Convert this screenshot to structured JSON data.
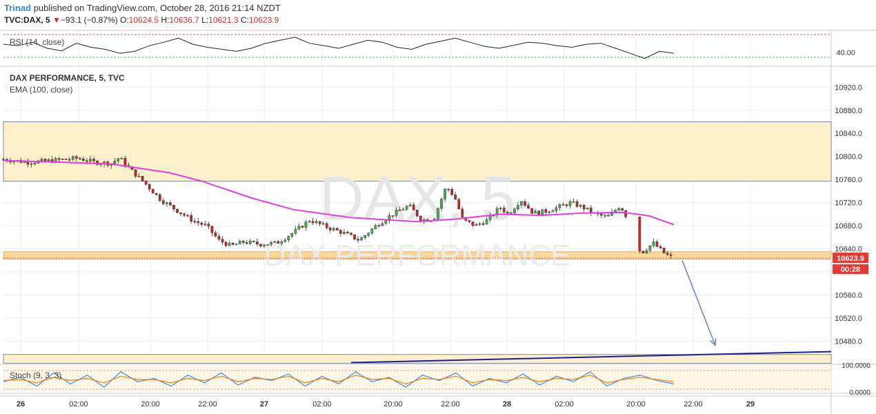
{
  "header": {
    "author": "Trinad",
    "published_text": "published on TradingView.com, October 28, 2016 21:14 NZDT",
    "symbol": "TVC:DAX, 5",
    "change_arrow": "▼",
    "change": "−93.1 (−0.87%)",
    "o_label": "O:",
    "o_value": "10624.5",
    "h_label": "H:",
    "h_value": "10636.7",
    "l_label": "L:",
    "l_value": "10621.3",
    "c_label": "C:",
    "c_value": "10623.9"
  },
  "rsi_pane": {
    "label": "RSI (14, close)",
    "tick": "40.00"
  },
  "main_pane": {
    "title": "DAX PERFORMANCE, 5, TVC",
    "ema_label": "EMA (100, close)",
    "watermark_big": "DAX, 5",
    "watermark_small": "DAX PERFORMANCE",
    "last_price": "10623.9",
    "countdown": "00:28"
  },
  "stoch_pane": {
    "label": "Stoch (9, 3, 3)",
    "tick_top": "100.0000",
    "tick_bottom": "0.0000"
  },
  "colors": {
    "up": "#4caf50",
    "down": "#c62828",
    "ema": "#e53be0",
    "zone": "#fdf0cc",
    "zone_strong": "#fbd79a",
    "trendline": "#1a1aa6",
    "arrow": "#6f86c9",
    "price_tag": "#e53935",
    "stoch_k": "#3a8ee6",
    "stoch_d": "#f57c00"
  },
  "chart_data": {
    "type": "candlestick",
    "y_ticks": [
      "10920.0",
      "10880.0",
      "10840.0",
      "10800.0",
      "10760.0",
      "10720.0",
      "10680.0",
      "10640.0",
      "10560.0",
      "10520.0",
      "10480.0"
    ],
    "ylim": [
      10440,
      10955
    ],
    "x_ticks": [
      "26",
      "02:00",
      "20:00",
      "22:00",
      "27",
      "02:00",
      "20:00",
      "22:00",
      "28",
      "02:00",
      "20:00",
      "22:00",
      "29"
    ],
    "price_path": [
      [
        0,
        10795
      ],
      [
        0.03,
        10790
      ],
      [
        0.06,
        10793
      ],
      [
        0.09,
        10797
      ],
      [
        0.11,
        10790
      ],
      [
        0.13,
        10788
      ],
      [
        0.14,
        10798
      ],
      [
        0.155,
        10775
      ],
      [
        0.17,
        10755
      ],
      [
        0.19,
        10725
      ],
      [
        0.21,
        10706
      ],
      [
        0.23,
        10688
      ],
      [
        0.245,
        10680
      ],
      [
        0.26,
        10655
      ],
      [
        0.275,
        10645
      ],
      [
        0.29,
        10652
      ],
      [
        0.31,
        10648
      ],
      [
        0.33,
        10650
      ],
      [
        0.35,
        10668
      ],
      [
        0.37,
        10690
      ],
      [
        0.39,
        10678
      ],
      [
        0.41,
        10668
      ],
      [
        0.43,
        10655
      ],
      [
        0.45,
        10680
      ],
      [
        0.47,
        10700
      ],
      [
        0.49,
        10715
      ],
      [
        0.505,
        10690
      ],
      [
        0.52,
        10692
      ],
      [
        0.535,
        10748
      ],
      [
        0.545,
        10730
      ],
      [
        0.555,
        10690
      ],
      [
        0.57,
        10680
      ],
      [
        0.585,
        10690
      ],
      [
        0.6,
        10712
      ],
      [
        0.61,
        10700
      ],
      [
        0.625,
        10725
      ],
      [
        0.64,
        10702
      ],
      [
        0.655,
        10705
      ],
      [
        0.67,
        10712
      ],
      [
        0.685,
        10720
      ],
      [
        0.7,
        10712
      ],
      [
        0.715,
        10700
      ],
      [
        0.73,
        10695
      ],
      [
        0.745,
        10715
      ],
      [
        0.755,
        10690
      ],
      [
        0.77,
        10632
      ],
      [
        0.785,
        10650
      ],
      [
        0.8,
        10630
      ],
      [
        0.81,
        10624
      ]
    ],
    "ema_path": [
      [
        0,
        10793
      ],
      [
        0.07,
        10790
      ],
      [
        0.13,
        10787
      ],
      [
        0.2,
        10772
      ],
      [
        0.24,
        10757
      ],
      [
        0.3,
        10728
      ],
      [
        0.35,
        10708
      ],
      [
        0.42,
        10694
      ],
      [
        0.5,
        10687
      ],
      [
        0.55,
        10692
      ],
      [
        0.6,
        10700
      ],
      [
        0.65,
        10698
      ],
      [
        0.7,
        10702
      ],
      [
        0.75,
        10703
      ],
      [
        0.78,
        10697
      ],
      [
        0.81,
        10682
      ]
    ],
    "zones": [
      {
        "y1": 10757,
        "y2": 10860,
        "strength": "normal"
      },
      {
        "y1": 10622,
        "y2": 10635,
        "strength": "strong"
      },
      {
        "y1": 10442,
        "y2": 10457,
        "strength": "normal"
      }
    ],
    "trendline": [
      [
        0.42,
        10443
      ],
      [
        1.0,
        10462
      ]
    ],
    "projection_arrow": [
      [
        0.82,
        10620
      ],
      [
        0.86,
        10473
      ]
    ],
    "rsi_values": [
      58,
      55,
      62,
      50,
      45,
      60,
      52,
      48,
      40,
      44,
      55,
      62,
      70,
      58,
      52,
      48,
      44,
      50,
      60,
      66,
      72,
      60,
      55,
      50,
      58,
      66,
      62,
      52,
      48,
      58,
      64,
      70,
      62,
      54,
      50,
      56,
      62,
      60,
      55,
      52,
      58,
      60,
      50,
      40,
      30,
      44,
      40
    ],
    "stoch_k": [
      40,
      60,
      20,
      80,
      30,
      70,
      15,
      85,
      40,
      55,
      20,
      70,
      35,
      80,
      25,
      60,
      45,
      75,
      20,
      65,
      30,
      85,
      40,
      60,
      15,
      70,
      45,
      80,
      20,
      55,
      35,
      75,
      25,
      65,
      40,
      85,
      20,
      55,
      70,
      45,
      30
    ],
    "stoch_d": [
      45,
      50,
      35,
      60,
      45,
      55,
      35,
      65,
      50,
      50,
      35,
      55,
      45,
      65,
      40,
      55,
      50,
      65,
      35,
      55,
      40,
      70,
      50,
      55,
      30,
      55,
      50,
      65,
      35,
      50,
      45,
      60,
      40,
      55,
      50,
      70,
      35,
      50,
      60,
      50,
      40
    ]
  }
}
